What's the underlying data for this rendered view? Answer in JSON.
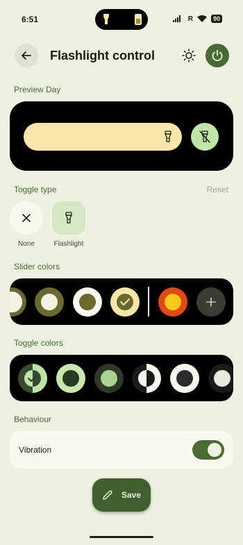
{
  "status": {
    "time": "6:51",
    "battery": "90",
    "network": "R"
  },
  "header": {
    "title": "Flashlight control",
    "back_icon": "arrow-left-icon",
    "theme_icon": "sun-icon",
    "power_icon": "power-icon"
  },
  "preview": {
    "label": "Preview Day",
    "slider_color": "#f8e8a8",
    "toggle_color": "#bfe6a8",
    "slider_icon": "flashlight-icon",
    "toggle_icon": "flashlight-off-icon"
  },
  "toggle_type": {
    "label": "Toggle type",
    "reset": "Reset",
    "options": [
      {
        "label": "None",
        "icon": "close-icon",
        "selected": false
      },
      {
        "label": "Flashlight",
        "icon": "flashlight-icon",
        "selected": true
      }
    ]
  },
  "slider_colors": {
    "label": "Slider colors",
    "add_icon": "plus-icon"
  },
  "toggle_colors": {
    "label": "Toggle colors"
  },
  "behaviour": {
    "label": "Behaviour",
    "vibration_label": "Vibration",
    "vibration_on": true
  },
  "save": {
    "label": "Save",
    "icon": "pencil-icon"
  },
  "colors": {
    "accent": "#4a6a33",
    "background": "#eef0e2"
  }
}
